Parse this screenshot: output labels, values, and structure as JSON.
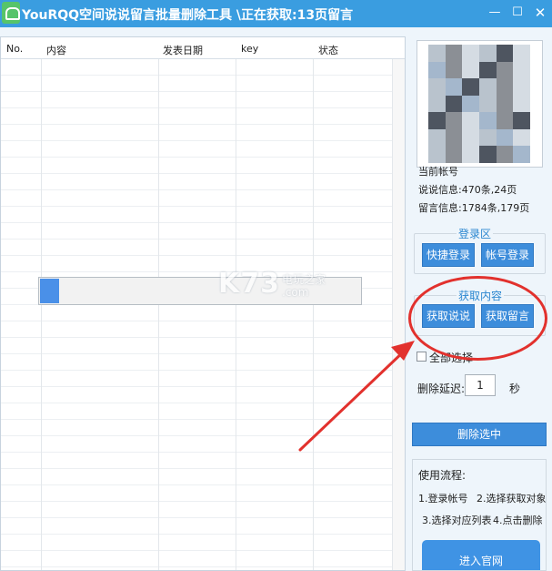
{
  "window": {
    "title": "YouRQQ空间说说留言批量删除工具 \\正在获取:13页留言",
    "minimize": "—",
    "maximize": "☐",
    "close": "✕"
  },
  "table": {
    "columns": [
      "No.",
      "内容",
      "发表日期",
      "key",
      "状态"
    ]
  },
  "progress": {
    "value_percent": 6
  },
  "watermark": {
    "main": "K73",
    "cn": "电玩之家",
    "url": ".com"
  },
  "account": {
    "current_label": "当前帐号",
    "shuoshuo_info": "说说信息:470条,24页",
    "message_info": "留言信息:1784条,179页"
  },
  "login_section": {
    "legend": "登录区",
    "quick_login": "快捷登录",
    "account_login": "帐号登录"
  },
  "fetch_section": {
    "legend": "获取内容",
    "fetch_shuoshuo": "获取说说",
    "fetch_messages": "获取留言"
  },
  "select_all": {
    "label": "全部选择",
    "checked": false
  },
  "delay": {
    "label": "删除延迟:",
    "value": "1",
    "unit": "秒"
  },
  "delete_button": "删除选中",
  "guide": {
    "title": "使用流程:",
    "step1": "1.登录帐号",
    "step2": "2.选择获取对象",
    "step3": "3.选择对应列表",
    "step4": "4.点击删除",
    "site_button": "进入官网"
  },
  "colors": {
    "titlebar": "#3a9de0",
    "button": "#3d8ddb",
    "annotation": "#e2312d"
  }
}
